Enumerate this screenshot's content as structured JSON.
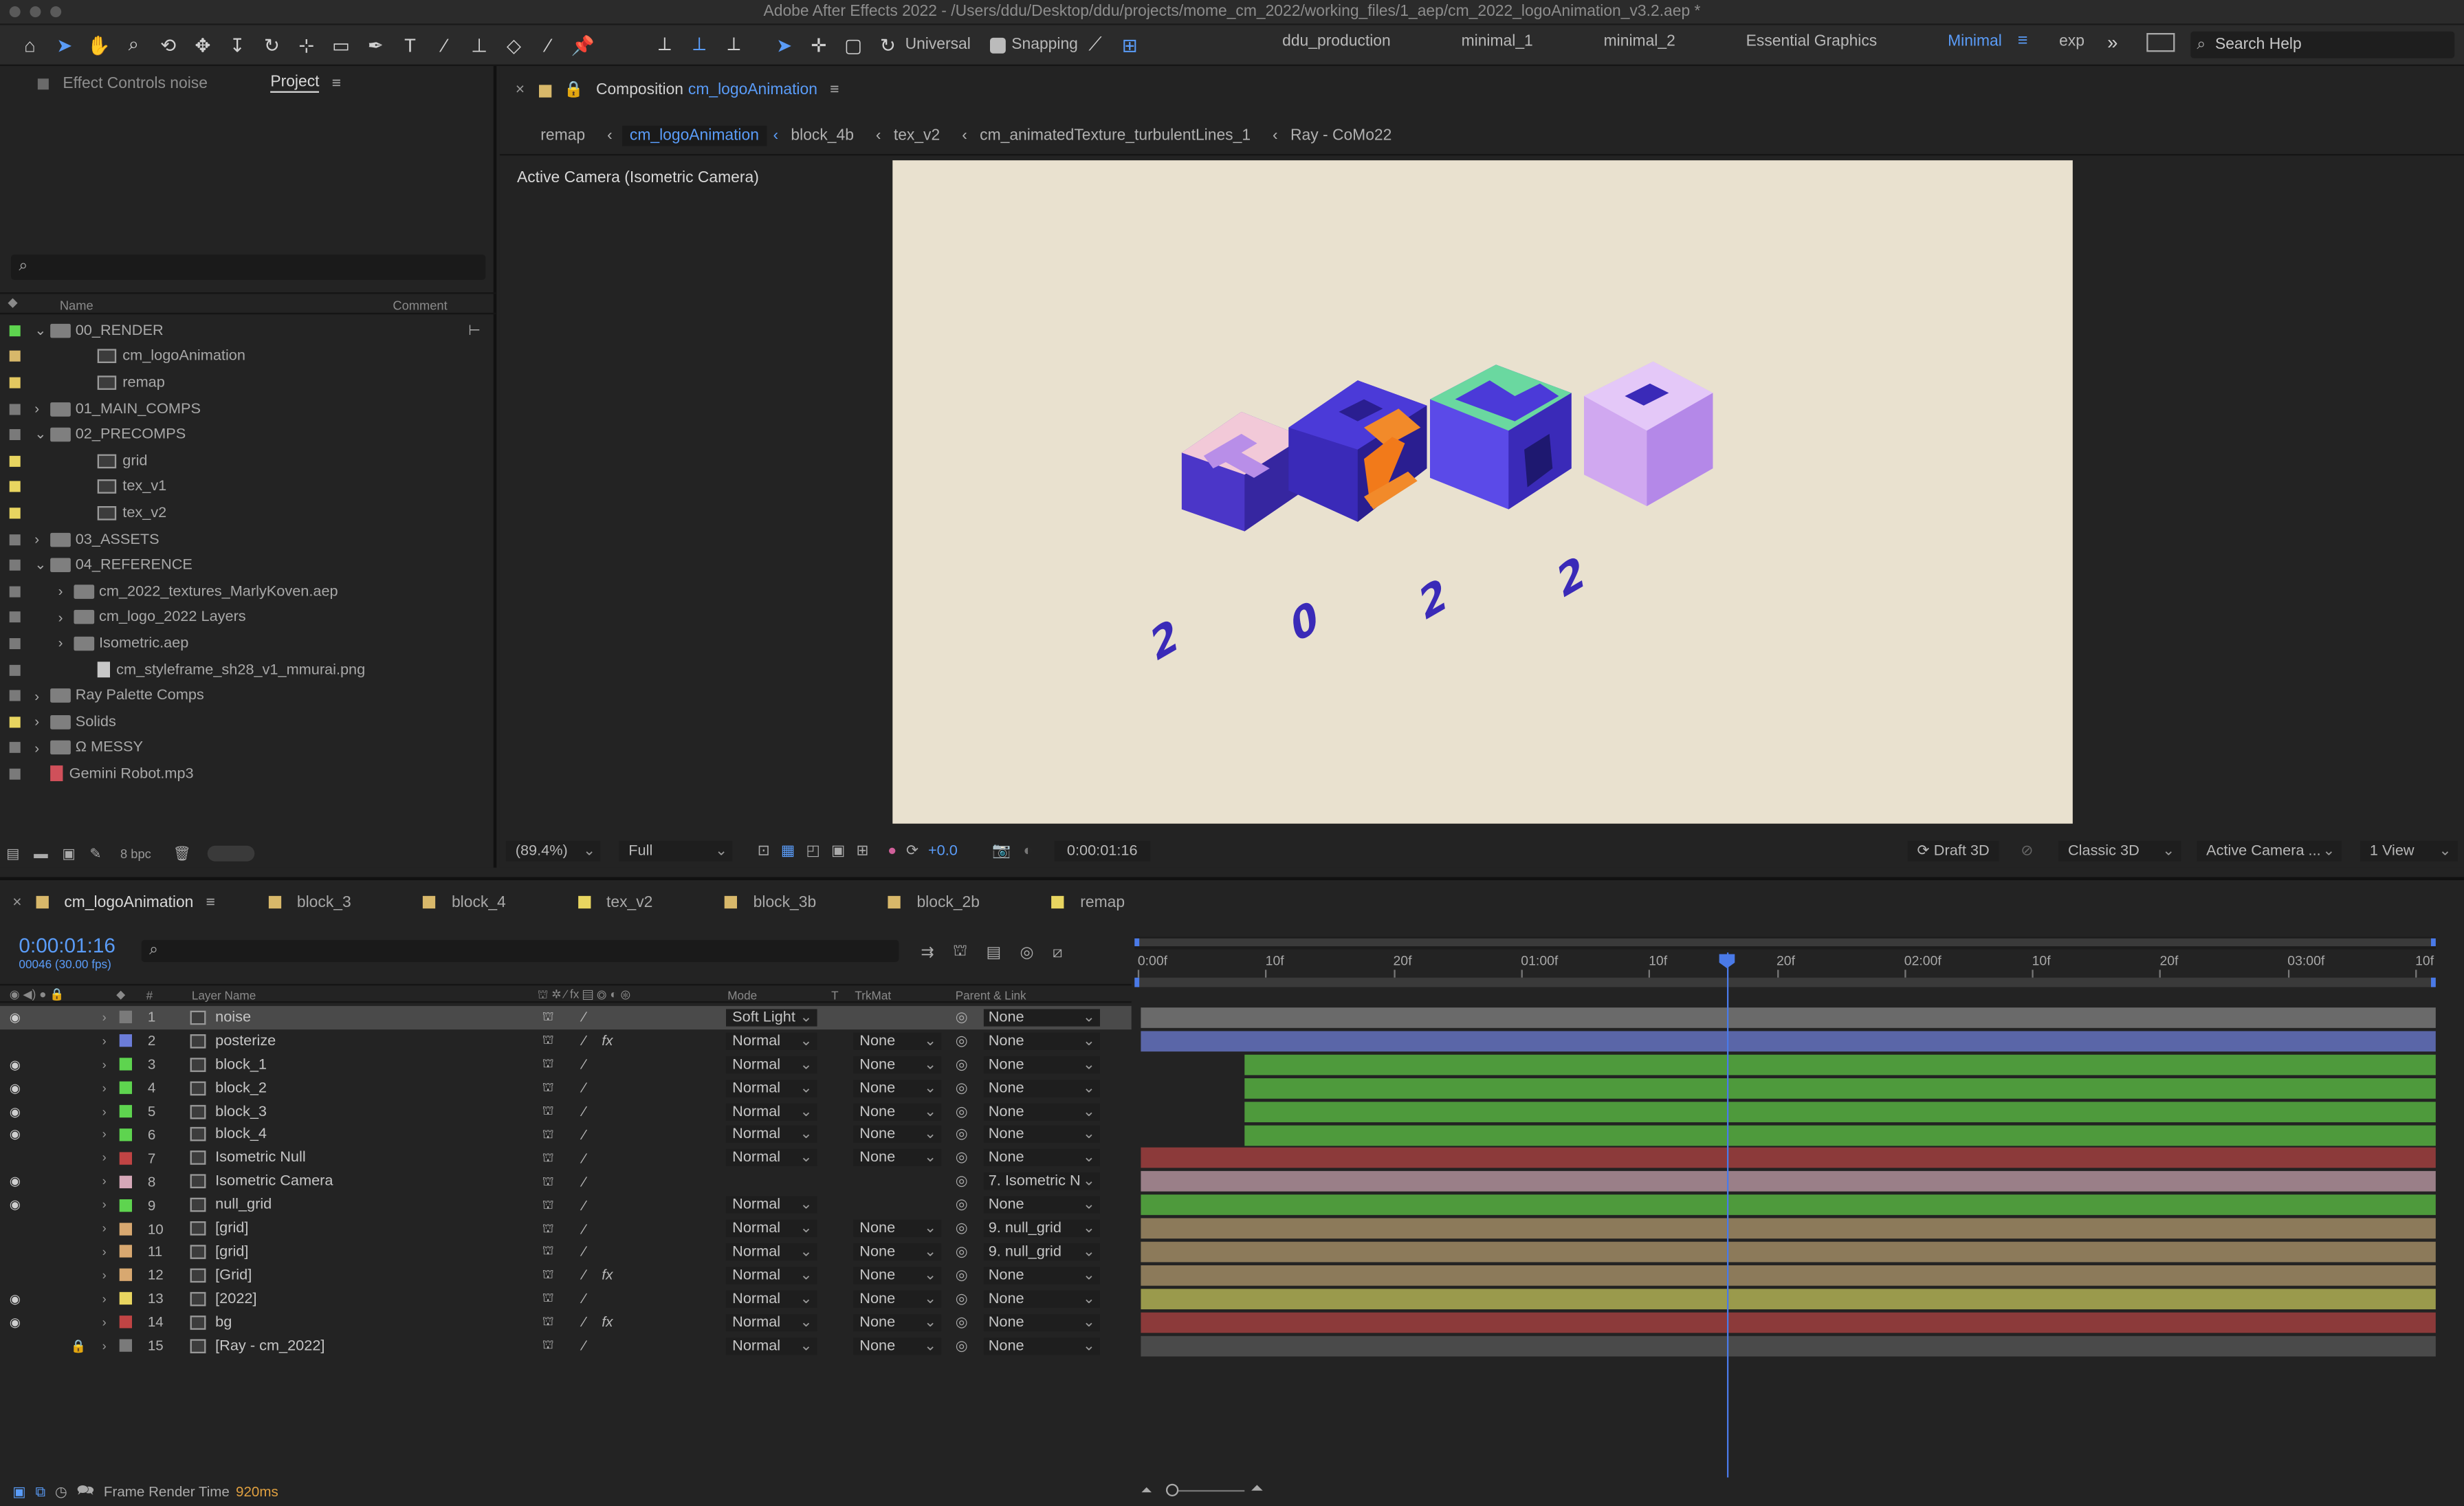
{
  "app": {
    "title": "Adobe After Effects 2022 - /Users/ddu/Desktop/ddu/projects/mome_cm_2022/working_files/1_aep/cm_2022_logoAnimation_v3.2.aep *"
  },
  "toolbar": {
    "universal_label": "Universal",
    "snapping_label": "Snapping",
    "workspaces": [
      "ddu_production",
      "minimal_1",
      "minimal_2",
      "Essential Graphics",
      "Minimal",
      "exp"
    ],
    "active_workspace": "Minimal",
    "search_placeholder": "Search Help"
  },
  "project_panel": {
    "tab_effect_controls": "Effect Controls noise",
    "tab_project": "Project",
    "search_placeholder": "",
    "col_name": "Name",
    "col_comment": "Comment",
    "items": [
      {
        "label": "00_RENDER",
        "type": "folder",
        "color": "#5ed44f",
        "indent": 0,
        "expanded": true
      },
      {
        "label": "cm_logoAnimation",
        "type": "comp",
        "color": "#d8b86a",
        "indent": 2
      },
      {
        "label": "remap",
        "type": "comp",
        "color": "#e3c860",
        "indent": 2
      },
      {
        "label": "01_MAIN_COMPS",
        "type": "folder",
        "color": "#7a7a7a",
        "indent": 0,
        "expanded": false
      },
      {
        "label": "02_PRECOMPS",
        "type": "folder",
        "color": "#7a7a7a",
        "indent": 0,
        "expanded": true
      },
      {
        "label": "grid",
        "type": "comp",
        "color": "#e8d560",
        "indent": 2
      },
      {
        "label": "tex_v1",
        "type": "comp",
        "color": "#e8d560",
        "indent": 2
      },
      {
        "label": "tex_v2",
        "type": "comp",
        "color": "#e8d560",
        "indent": 2
      },
      {
        "label": "03_ASSETS",
        "type": "folder",
        "color": "#7a7a7a",
        "indent": 0,
        "expanded": false
      },
      {
        "label": "04_REFERENCE",
        "type": "folder",
        "color": "#7a7a7a",
        "indent": 0,
        "expanded": true
      },
      {
        "label": "cm_2022_textures_MarlyKoven.aep",
        "type": "folder",
        "color": "#7a7a7a",
        "indent": 1,
        "expanded": false
      },
      {
        "label": "cm_logo_2022 Layers",
        "type": "folder",
        "color": "#7a7a7a",
        "indent": 1,
        "expanded": false
      },
      {
        "label": "Isometric.aep",
        "type": "folder",
        "color": "#7a7a7a",
        "indent": 1,
        "expanded": false
      },
      {
        "label": "cm_styleframe_sh28_v1_mmurai.png",
        "type": "file",
        "color": "#7a7a7a",
        "indent": 2
      },
      {
        "label": "Ray Palette Comps",
        "type": "folder",
        "color": "#7a7a7a",
        "indent": 0,
        "expanded": false
      },
      {
        "label": "Solids",
        "type": "folder",
        "color": "#e8d560",
        "indent": 0,
        "expanded": false
      },
      {
        "label": "Ω MESSY",
        "type": "folder",
        "color": "#7a7a7a",
        "indent": 0,
        "expanded": false
      },
      {
        "label": "Gemini Robot.mp3",
        "type": "mp3",
        "color": "#7a7a7a",
        "indent": 0
      }
    ],
    "bpc": "8 bpc"
  },
  "composition_panel": {
    "tab_prefix": "Composition",
    "tab_name": "cm_logoAnimation",
    "breadcrumbs": [
      "remap",
      "cm_logoAnimation",
      "block_4b",
      "tex_v2",
      "cm_animatedTexture_turbulentLines_1",
      "Ray - CoMo22"
    ],
    "camera_label": "Active Camera (Isometric Camera)",
    "zoom": "(89.4%)",
    "resolution": "Full",
    "exposure": "+0.0",
    "timecode": "0:00:01:16",
    "draft3d": "Draft 3D",
    "renderer": "Classic 3D",
    "camera_select": "Active Camera ...",
    "view_select": "1 View"
  },
  "logo": {
    "digits": [
      "2",
      "0",
      "2",
      "2"
    ]
  },
  "timeline": {
    "tabs": [
      {
        "label": "cm_logoAnimation",
        "color": "#d8b86a",
        "active": true
      },
      {
        "label": "block_3",
        "color": "#d8b86a"
      },
      {
        "label": "block_4",
        "color": "#d8b86a"
      },
      {
        "label": "tex_v2",
        "color": "#e8d560"
      },
      {
        "label": "block_3b",
        "color": "#d8b86a"
      },
      {
        "label": "block_2b",
        "color": "#d8b86a"
      },
      {
        "label": "remap",
        "color": "#e8d560"
      }
    ],
    "current_time": "0:00:01:16",
    "frame_info": "00046 (30.00 fps)",
    "search_placeholder": "",
    "headers": {
      "layer_name": "Layer Name",
      "mode": "Mode",
      "t": "T",
      "trkmat": "TrkMat",
      "parent": "Parent & Link",
      "num": "#"
    },
    "ruler": [
      "0:00f",
      "10f",
      "20f",
      "01:00f",
      "10f",
      "20f",
      "02:00f",
      "10f",
      "20f",
      "03:00f",
      "10f"
    ],
    "layers": [
      {
        "num": "1",
        "name": "noise",
        "color": "#7a7a7a",
        "mode": "Soft Light",
        "trkmat": "",
        "parent": "None",
        "eye": true,
        "bar": "#6a6a6a",
        "start": 0.0,
        "fx": false,
        "selected": true
      },
      {
        "num": "2",
        "name": "posterize",
        "color": "#6b7cd8",
        "mode": "Normal",
        "trkmat": "None",
        "parent": "None",
        "eye": false,
        "bar": "#5a66a8",
        "start": 0.0,
        "fx": true
      },
      {
        "num": "3",
        "name": "block_1",
        "color": "#5ed44f",
        "mode": "Normal",
        "trkmat": "None",
        "parent": "None",
        "eye": true,
        "bar": "#4e9a3c",
        "start": 0.08,
        "fx": false
      },
      {
        "num": "4",
        "name": "block_2",
        "color": "#5ed44f",
        "mode": "Normal",
        "trkmat": "None",
        "parent": "None",
        "eye": true,
        "bar": "#4e9a3c",
        "start": 0.08,
        "fx": false
      },
      {
        "num": "5",
        "name": "block_3",
        "color": "#5ed44f",
        "mode": "Normal",
        "trkmat": "None",
        "parent": "None",
        "eye": true,
        "bar": "#4e9a3c",
        "start": 0.08,
        "fx": false
      },
      {
        "num": "6",
        "name": "block_4",
        "color": "#5ed44f",
        "mode": "Normal",
        "trkmat": "None",
        "parent": "None",
        "eye": true,
        "bar": "#4e9a3c",
        "start": 0.08,
        "fx": false
      },
      {
        "num": "7",
        "name": "Isometric Null",
        "color": "#c04444",
        "mode": "Normal",
        "trkmat": "None",
        "parent": "None",
        "eye": false,
        "bar": "#8c3a3a",
        "start": 0.0,
        "fx": false
      },
      {
        "num": "8",
        "name": "Isometric Camera",
        "color": "#d6a8b8",
        "mode": "",
        "trkmat": "",
        "parent": "7. Isometric N",
        "eye": true,
        "bar": "#9a7f88",
        "start": 0.0,
        "fx": false
      },
      {
        "num": "9",
        "name": "null_grid",
        "color": "#5ed44f",
        "mode": "Normal",
        "trkmat": "",
        "parent": "None",
        "eye": true,
        "bar": "#4e9a3c",
        "start": 0.0,
        "fx": false
      },
      {
        "num": "10",
        "name": "[grid]",
        "color": "#d8a870",
        "mode": "Normal",
        "trkmat": "None",
        "parent": "9. null_grid",
        "eye": false,
        "bar": "#8c7a5a",
        "start": 0.0,
        "fx": false
      },
      {
        "num": "11",
        "name": "[grid]",
        "color": "#d8a870",
        "mode": "Normal",
        "trkmat": "None",
        "parent": "9. null_grid",
        "eye": false,
        "bar": "#8c7a5a",
        "start": 0.0,
        "fx": false
      },
      {
        "num": "12",
        "name": "[Grid]",
        "color": "#d8a870",
        "mode": "Normal",
        "trkmat": "None",
        "parent": "None",
        "eye": false,
        "bar": "#8c7a5a",
        "start": 0.0,
        "fx": true
      },
      {
        "num": "13",
        "name": "[2022]",
        "color": "#e8d560",
        "mode": "Normal",
        "trkmat": "None",
        "parent": "None",
        "eye": true,
        "bar": "#9a9a4c",
        "start": 0.0,
        "fx": false
      },
      {
        "num": "14",
        "name": "bg",
        "color": "#c04444",
        "mode": "Normal",
        "trkmat": "None",
        "parent": "None",
        "eye": true,
        "bar": "#8c3a3a",
        "start": 0.0,
        "fx": true
      },
      {
        "num": "15",
        "name": "[Ray - cm_2022]",
        "color": "#7a7a7a",
        "mode": "Normal",
        "trkmat": "None",
        "parent": "None",
        "eye": false,
        "bar": "#4a4a4a",
        "start": 0.0,
        "fx": false,
        "locked": true
      }
    ]
  },
  "statusbar": {
    "label": "Frame Render Time",
    "value": "920ms"
  }
}
